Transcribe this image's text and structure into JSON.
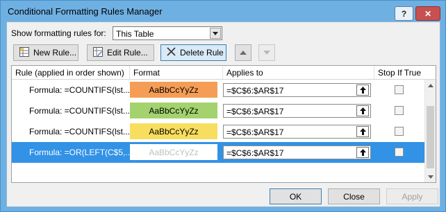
{
  "window": {
    "title": "Conditional Formatting Rules Manager",
    "help_label": "?",
    "close_label": "✕"
  },
  "show_rules": {
    "label": "Show formatting rules for:",
    "selected": "This Table"
  },
  "toolbar": {
    "new_rule": "New Rule...",
    "edit_rule": "Edit Rule...",
    "delete_rule": "Delete Rule"
  },
  "columns": {
    "rule": "Rule (applied in order shown)",
    "format": "Format",
    "applies_to": "Applies to",
    "stop_if_true": "Stop If True"
  },
  "rules": [
    {
      "rule": "Formula: =COUNTIFS(lst...",
      "format_preview": "AaBbCcYyZz",
      "format_color": "#f59d56",
      "applies_to": "=$C$6:$AR$17",
      "stop_if_true": false
    },
    {
      "rule": "Formula: =COUNTIFS(lst...",
      "format_preview": "AaBbCcYyZz",
      "format_color": "#a3d26f",
      "applies_to": "=$C$6:$AR$17",
      "stop_if_true": false
    },
    {
      "rule": "Formula: =COUNTIFS(lst...",
      "format_preview": "AaBbCcYyZz",
      "format_color": "#f8de5e",
      "applies_to": "=$C$6:$AR$17",
      "stop_if_true": false
    },
    {
      "rule": "Formula: =OR(LEFT(C$5,...",
      "format_preview": "AaBbCcYyZz",
      "format_color": "#ffffff",
      "applies_to": "=$C$6:$AR$17",
      "stop_if_true": false,
      "selected": true
    }
  ],
  "footer": {
    "ok": "OK",
    "close": "Close",
    "apply": "Apply"
  }
}
